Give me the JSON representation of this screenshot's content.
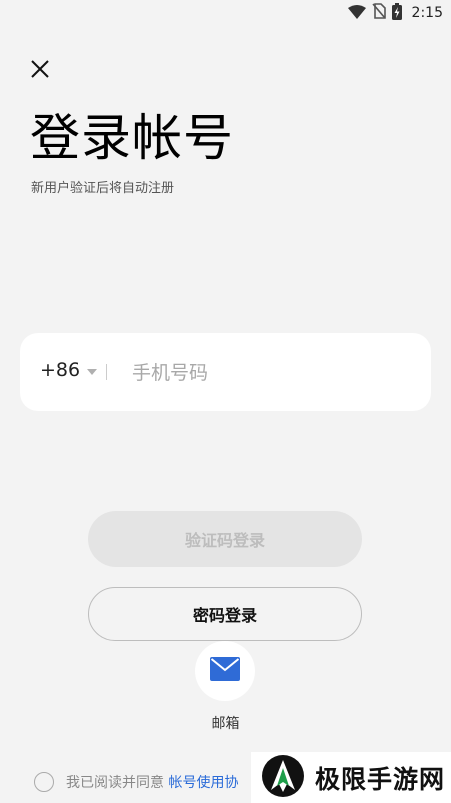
{
  "status_bar": {
    "time": "2:15",
    "icons": [
      "wifi-icon",
      "no-sim-icon",
      "battery-charging-icon"
    ]
  },
  "header": {
    "close_icon": "close-icon",
    "title": "登录帐号",
    "subtitle": "新用户验证后将自动注册"
  },
  "phone": {
    "country_code": "+86",
    "dropdown_icon": "chevron-down-icon",
    "placeholder": "手机号码",
    "value": ""
  },
  "actions": {
    "sms_login_label": "验证码登录",
    "password_login_label": "密码登录",
    "email_icon": "mail-icon",
    "email_label": "邮箱"
  },
  "agreement": {
    "text": "我已阅读并同意",
    "link": "帐号使用协"
  },
  "watermark": {
    "text": "极限手游网"
  },
  "colors": {
    "background": "#f3f3f3",
    "link": "#2a6bd8",
    "email_icon": "#2f6bd6",
    "disabled_button": "#e4e4e4"
  }
}
